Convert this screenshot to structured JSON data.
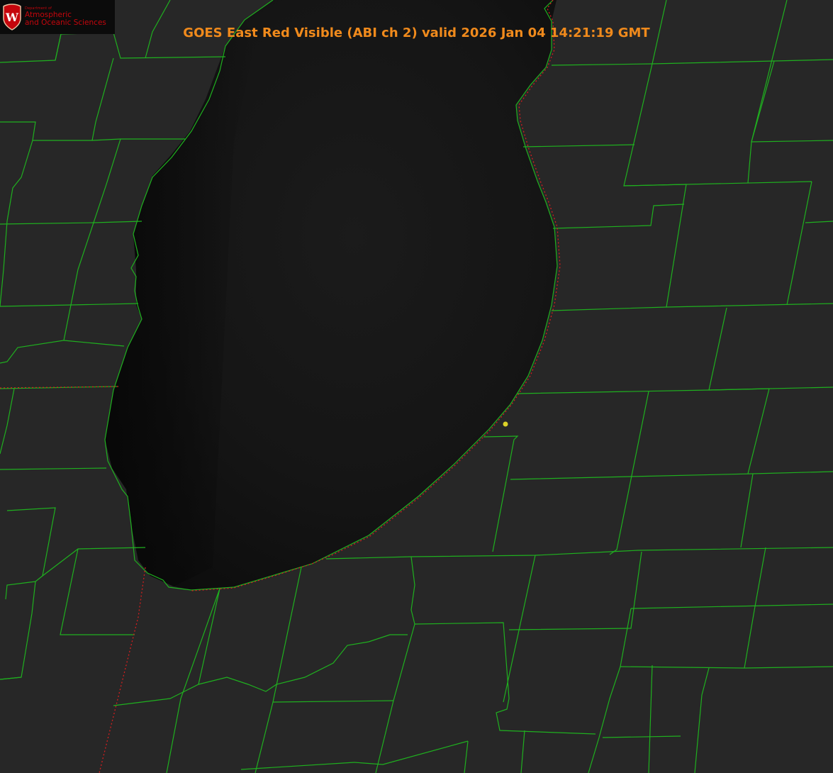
{
  "title": "GOES East Red Visible (ABI ch 2) valid 2026 Jan 04 14:21:19 GMT",
  "logo": {
    "department": "Department of",
    "line1": "Atmospheric",
    "line2": "and Oceanic Sciences",
    "crest_letter": "W"
  },
  "colors": {
    "land": "#2a2a2a",
    "lake": "#141414",
    "county_lines": "#1fb01f",
    "state_lines": "#d21e1e",
    "title": "#f08a1c",
    "marker": "#dcd228",
    "logo_red": "#c5050c"
  }
}
